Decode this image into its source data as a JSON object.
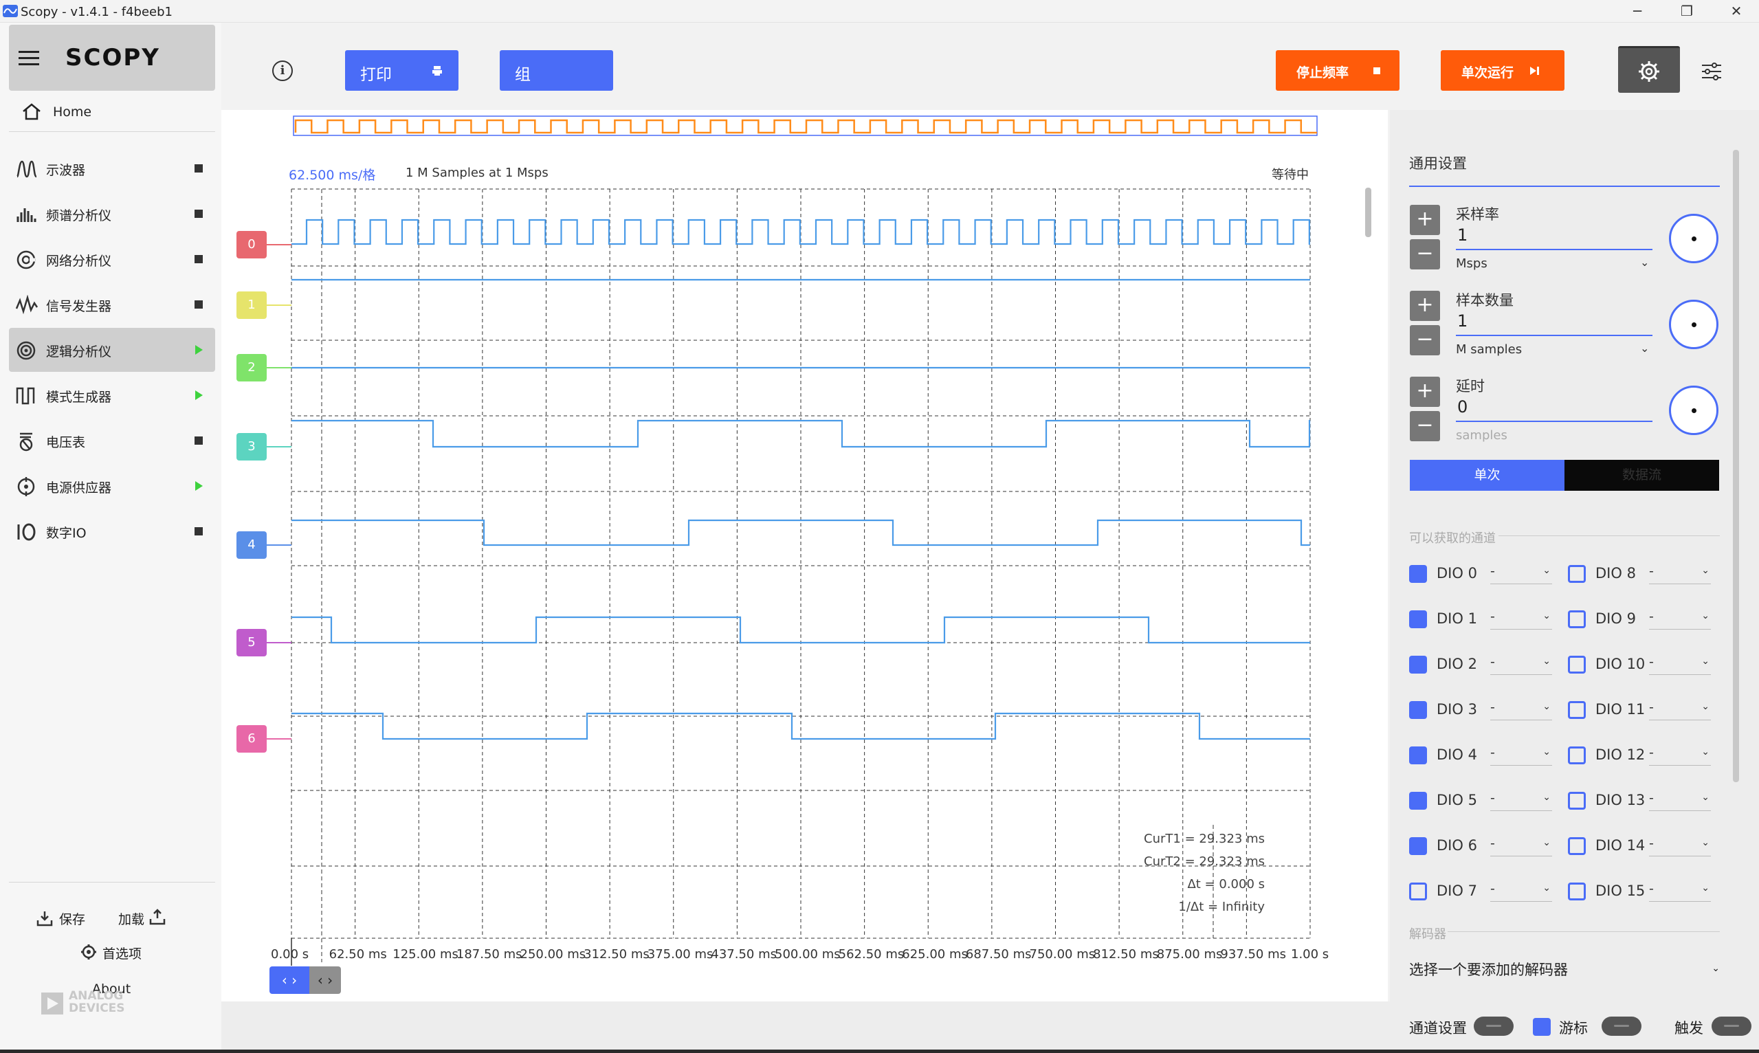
{
  "window": {
    "title": "Scopy - v1.4.1 - f4beeb1",
    "minimize": "─",
    "restore": "❐",
    "close": "✕"
  },
  "sidebar": {
    "logo": "SCOPY",
    "home_label": "Home",
    "items": [
      {
        "label": "示波器",
        "icon": "oscilloscope-icon",
        "status": "stopped"
      },
      {
        "label": "频谱分析仪",
        "icon": "spectrum-icon",
        "status": "stopped"
      },
      {
        "label": "网络分析仪",
        "icon": "network-icon",
        "status": "stopped"
      },
      {
        "label": "信号发生器",
        "icon": "signal-generator-icon",
        "status": "stopped"
      },
      {
        "label": "逻辑分析仪",
        "icon": "logic-analyzer-icon",
        "status": "running",
        "active": true
      },
      {
        "label": "模式生成器",
        "icon": "pattern-generator-icon",
        "status": "running"
      },
      {
        "label": "电压表",
        "icon": "voltmeter-icon",
        "status": "stopped"
      },
      {
        "label": "电源供应器",
        "icon": "power-supply-icon",
        "status": "running"
      },
      {
        "label": "数字IO",
        "icon": "digital-io-icon",
        "status": "stopped"
      }
    ],
    "save_label": "保存",
    "load_label": "加载",
    "preferences_label": "首选项",
    "about_label": "About",
    "brand_line1": "ANALOG",
    "brand_line2": "DEVICES"
  },
  "toolbar": {
    "print_label": "打印",
    "group_label": "组",
    "stop_label": "停止频率",
    "single_run_label": "单次运行"
  },
  "plot": {
    "timebase": "62.500 ms/格",
    "samples_info": "1 M Samples at 1 Msps",
    "status": "等待中",
    "channels": [
      "0",
      "1",
      "2",
      "3",
      "4",
      "5",
      "6"
    ],
    "channel_colors": [
      "#e8686f",
      "#e6e46b",
      "#7fe36a",
      "#5cd4c0",
      "#5a8fe8",
      "#c05ccc",
      "#e868a8"
    ],
    "x_ticks": [
      "0.00 s",
      "62.50 ms",
      "125.00 ms",
      "187.50 ms",
      "250.00 ms",
      "312.50 ms",
      "375.00 ms",
      "437.50 ms",
      "500.00 ms",
      "562.50 ms",
      "625.00 ms",
      "687.50 ms",
      "750.00 ms",
      "812.50 ms",
      "875.00 ms",
      "937.50 ms",
      "1.00 s"
    ],
    "cursor": {
      "t1": "CurT1 = 29.323 ms",
      "t2": "CurT2 = 29.323 ms",
      "dt": "Δt = 0.000 s",
      "inv_dt": "1/Δt = Infinity"
    },
    "nav_left": "‹ ›",
    "nav_right": "‹ ›"
  },
  "settings": {
    "title": "通用设置",
    "sample_rate_label": "采样率",
    "sample_rate_value": "1",
    "sample_rate_unit": "Msps",
    "sample_count_label": "样本数量",
    "sample_count_value": "1",
    "sample_count_unit": "M samples",
    "delay_label": "延时",
    "delay_value": "0",
    "delay_unit": "samples",
    "mode_single": "单次",
    "mode_stream": "数据流",
    "channels_section": "可以获取的通道",
    "dio_left": [
      {
        "label": "DIO 0",
        "checked": true,
        "value": "-"
      },
      {
        "label": "DIO 1",
        "checked": true,
        "value": "-"
      },
      {
        "label": "DIO 2",
        "checked": true,
        "value": "-"
      },
      {
        "label": "DIO 3",
        "checked": true,
        "value": "-"
      },
      {
        "label": "DIO 4",
        "checked": true,
        "value": "-"
      },
      {
        "label": "DIO 5",
        "checked": true,
        "value": "-"
      },
      {
        "label": "DIO 6",
        "checked": true,
        "value": "-"
      },
      {
        "label": "DIO 7",
        "checked": false,
        "value": "-"
      }
    ],
    "dio_right": [
      {
        "label": "DIO 8",
        "checked": false,
        "value": "-"
      },
      {
        "label": "DIO 9",
        "checked": false,
        "value": "-"
      },
      {
        "label": "DIO 10",
        "checked": false,
        "value": "-"
      },
      {
        "label": "DIO 11",
        "checked": false,
        "value": "-"
      },
      {
        "label": "DIO 12",
        "checked": false,
        "value": "-"
      },
      {
        "label": "DIO 13",
        "checked": false,
        "value": "-"
      },
      {
        "label": "DIO 14",
        "checked": false,
        "value": "-"
      },
      {
        "label": "DIO 15",
        "checked": false,
        "value": "-"
      }
    ],
    "decoder_section": "解码器",
    "decoder_placeholder": "选择一个要添加的解码器"
  },
  "bottom_bar": {
    "channel_settings": "通道设置",
    "cursors": "游标",
    "trigger": "触发"
  },
  "colors": {
    "accent": "#4a6cf7",
    "run_button": "#ff5b0a",
    "waveform": "#4a9be8",
    "overview": "#ff8c1a"
  }
}
